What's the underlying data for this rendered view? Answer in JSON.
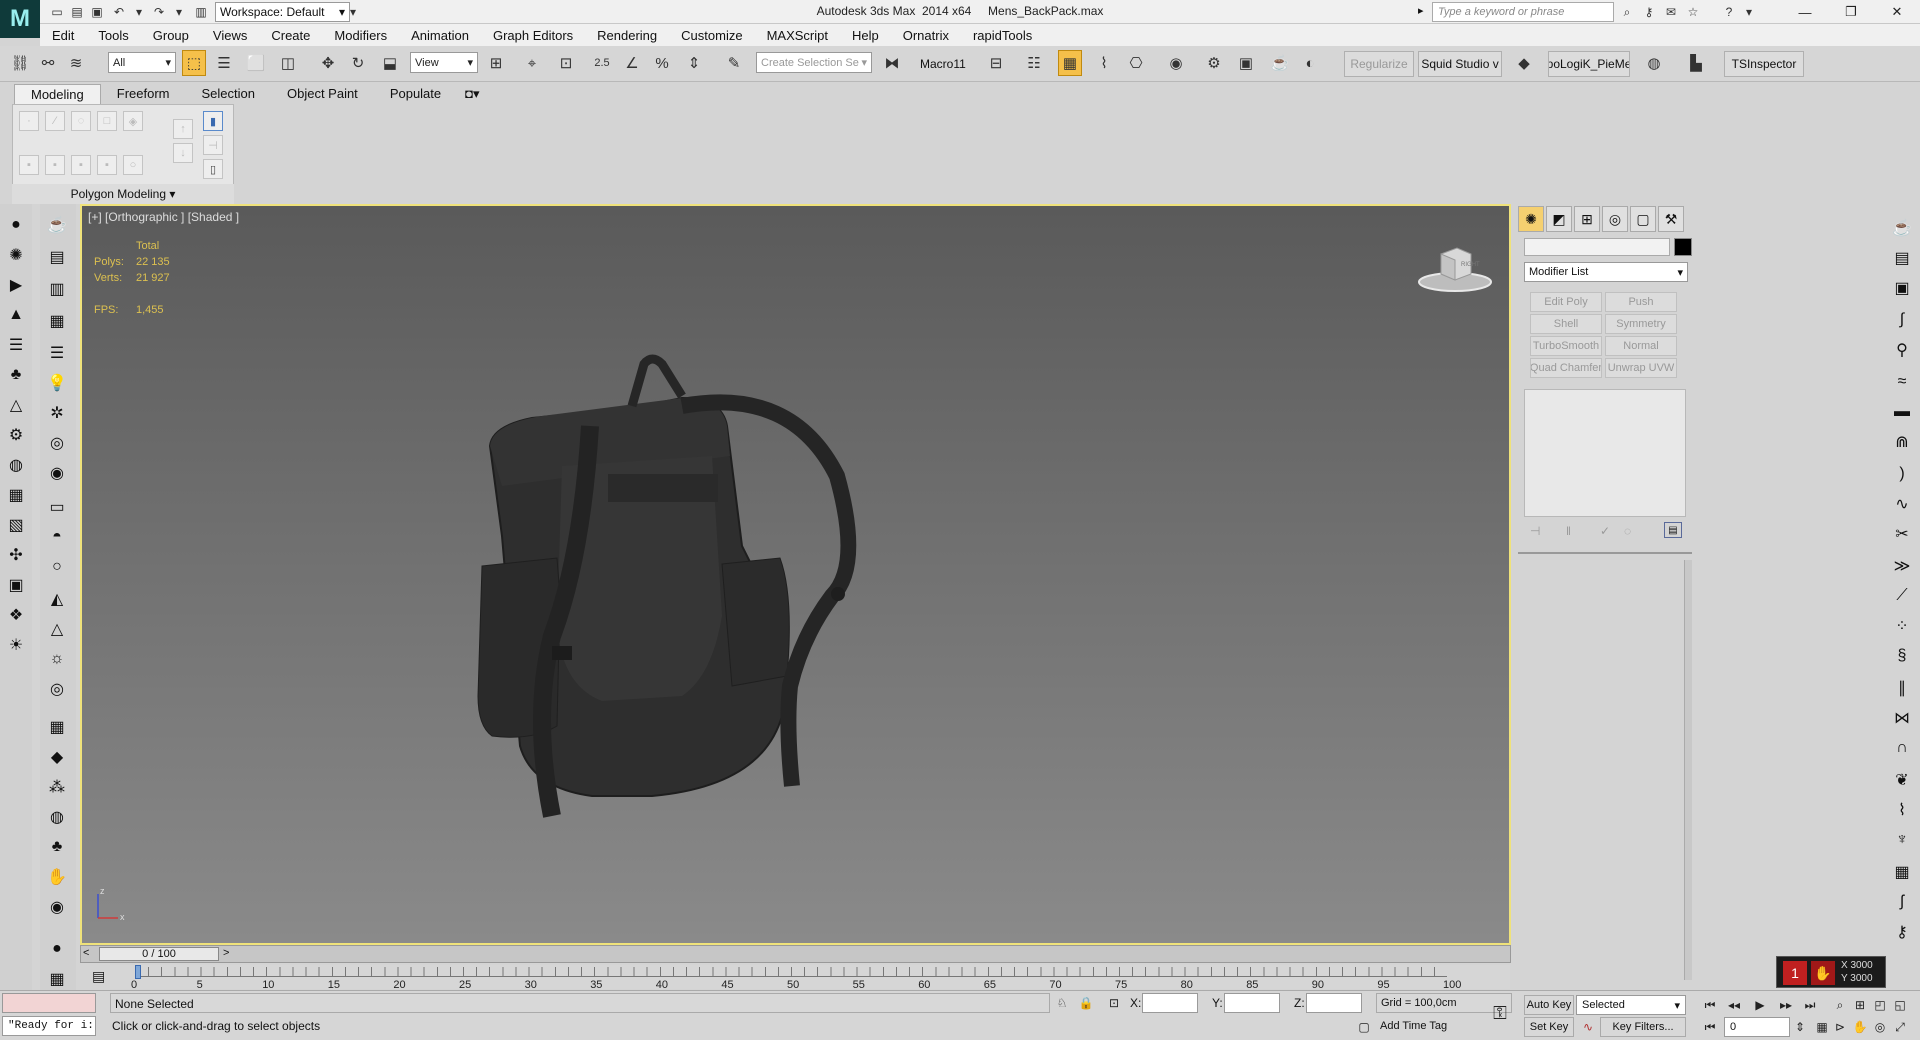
{
  "app": {
    "title": "Autodesk 3ds Max  2014 x64     Mens_BackPack.max",
    "logo_text": "M",
    "workspace_label": "Workspace: Default",
    "search_placeholder": "Type a keyword or phrase"
  },
  "menu": [
    "Edit",
    "Tools",
    "Group",
    "Views",
    "Create",
    "Modifiers",
    "Animation",
    "Graph Editors",
    "Rendering",
    "Customize",
    "MAXScript",
    "Help",
    "Ornatrix",
    "rapidTools"
  ],
  "toolbar": {
    "filter_select": "All",
    "refcoord_select": "View",
    "snap_label": "2.5",
    "selection_set_placeholder": "Create Selection Se",
    "macro_label": "Macro11",
    "buttons": [
      "Regularize",
      "Squid Studio v",
      "poLogiK_PieMe",
      "TSInspector"
    ]
  },
  "ribbon": {
    "tabs": [
      "Modeling",
      "Freeform",
      "Selection",
      "Object Paint",
      "Populate"
    ],
    "active_tab": "Modeling",
    "panel_label": "Polygon Modeling"
  },
  "viewport": {
    "label": "[+] [Orthographic ] [Shaded ]",
    "stats": {
      "header": "Total",
      "polys_label": "Polys:",
      "polys_value": "22 135",
      "verts_label": "Verts:",
      "verts_value": "21 927",
      "fps_label": "FPS:",
      "fps_value": "1,455"
    },
    "axis_labels": {
      "x": "x",
      "z": "z"
    },
    "viewcube_text": "RIGHT"
  },
  "command_panel": {
    "modifier_list_label": "Modifier List",
    "modifier_buttons": [
      "Edit Poly",
      "Push",
      "Shell",
      "Symmetry",
      "TurboSmooth",
      "Normal",
      "Quad Chamfer",
      "Unwrap UVW"
    ]
  },
  "timeline": {
    "frame_label": "0 / 100",
    "ticks": [
      "0",
      "5",
      "10",
      "15",
      "20",
      "25",
      "30",
      "35",
      "40",
      "45",
      "50",
      "55",
      "60",
      "65",
      "70",
      "75",
      "80",
      "85",
      "90",
      "95",
      "100"
    ]
  },
  "status": {
    "maxscript_text": "\"Ready for i:",
    "selection_status": "None Selected",
    "prompt": "Click or click-and-drag to select objects",
    "x_label": "X:",
    "y_label": "Y:",
    "z_label": "Z:",
    "grid": "Grid = 100,0cm",
    "add_time_tag": "Add Time Tag",
    "auto_key": "Auto Key",
    "set_key": "Set Key",
    "selected_select": "Selected",
    "key_filters": "Key Filters...",
    "frame_field": "0"
  },
  "vray_overlay": {
    "x": "X 3000",
    "y": "Y 3000"
  },
  "colors": {
    "viewport_border": "#efe27a",
    "active_tool": "#f5c04a",
    "stats_text": "#dcc050"
  }
}
